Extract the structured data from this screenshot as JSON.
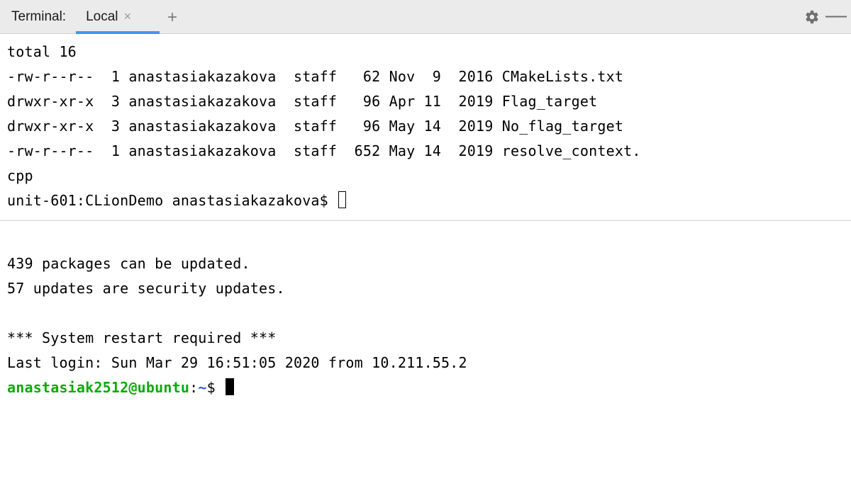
{
  "header": {
    "title": "Terminal:",
    "tab_label": "Local"
  },
  "pane1": {
    "lines": [
      "total 16",
      "-rw-r--r--  1 anastasiakazakova  staff   62 Nov  9  2016 CMakeLists.txt",
      "drwxr-xr-x  3 anastasiakazakova  staff   96 Apr 11  2019 Flag_target",
      "drwxr-xr-x  3 anastasiakazakova  staff   96 May 14  2019 No_flag_target",
      "-rw-r--r--  1 anastasiakazakova  staff  652 May 14  2019 resolve_context.",
      "cpp"
    ],
    "prompt": "unit-601:CLionDemo anastasiakazakova$ "
  },
  "pane2": {
    "lines": [
      "",
      "439 packages can be updated.",
      "57 updates are security updates.",
      "",
      "*** System restart required ***",
      "Last login: Sun Mar 29 16:51:05 2020 from 10.211.55.2"
    ],
    "prompt_user": "anastasiak2512@ubuntu",
    "prompt_colon": ":",
    "prompt_path": "~",
    "prompt_tail": "$ "
  }
}
